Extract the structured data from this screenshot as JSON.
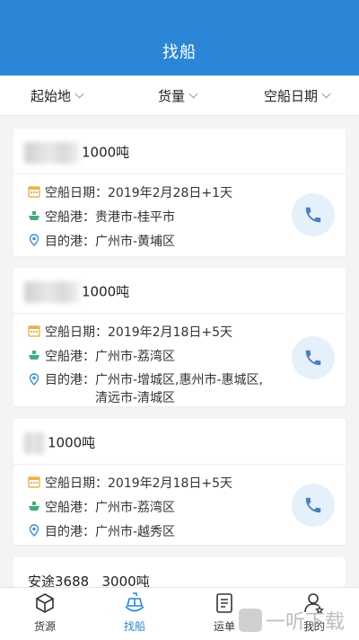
{
  "header": {
    "title": "找船"
  },
  "filters": [
    {
      "label": "起始地"
    },
    {
      "label": "货量"
    },
    {
      "label": "空船日期"
    }
  ],
  "cards": [
    {
      "ship": "1000吨",
      "date_label": "空船日期：",
      "date_value": "2019年2月28日+1天",
      "from_label": "空船港：",
      "from_value": "贵港市-桂平市",
      "to_label": "目的港：",
      "to_value": "广州市-黄埔区"
    },
    {
      "ship": "1000吨",
      "date_label": "空船日期：",
      "date_value": "2019年2月18日+5天",
      "from_label": "空船港：",
      "from_value": "广州市-荔湾区",
      "to_label": "目的港：",
      "to_value": "广州市-增城区,惠州市-惠城区,\n清远市-清城区"
    },
    {
      "ship": "1000吨",
      "date_label": "空船日期：",
      "date_value": "2019年2月18日+5天",
      "from_label": "空船港：",
      "from_value": "广州市-荔湾区",
      "to_label": "目的港：",
      "to_value": "广州市-越秀区"
    },
    {
      "ship": "安途3688   3000吨"
    }
  ],
  "tabbar": [
    {
      "label": "货源",
      "icon": "cube-icon"
    },
    {
      "label": "找船",
      "icon": "ship-icon"
    },
    {
      "label": "运单",
      "icon": "waybill-icon"
    },
    {
      "label": "我的",
      "icon": "profile-icon"
    }
  ],
  "watermark": {
    "text": "一听下载"
  },
  "colors": {
    "primary": "#2b86d8",
    "icon_orange": "#f0b04a",
    "icon_green": "#3bb07b",
    "icon_blue": "#3e8fd8"
  }
}
